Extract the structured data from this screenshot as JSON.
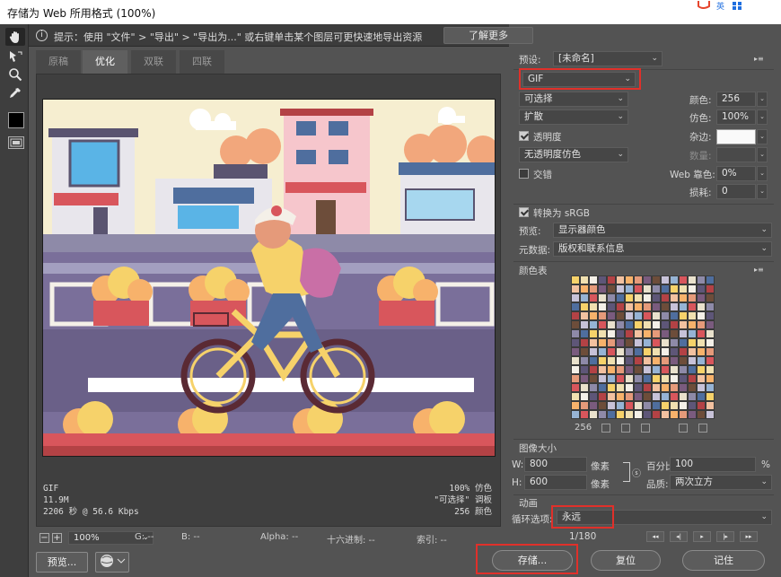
{
  "window": {
    "title": "存储为 Web 所用格式 (100%)",
    "logo_text": "英"
  },
  "hint": {
    "text": "提示：使用 \"文件\" > \"导出\" > \"导出为...\" 或右键单击某个图层可更快速地导出资源",
    "learn_more": "了解更多"
  },
  "tabs": [
    "原稿",
    "优化",
    "双联",
    "四联"
  ],
  "active_tab": "优化",
  "image_info": {
    "format": "GIF",
    "size": "11.9M",
    "download_time": "2206 秒 @ 56.6 Kbps",
    "dither": "100% 仿色",
    "palette": "\"可选择\" 调板",
    "colors": "256 颜色"
  },
  "statusbar": {
    "zoom": "100%",
    "g": "G: --",
    "b": "B: --",
    "alpha": "Alpha: --",
    "hex": "十六进制: --",
    "index": "索引: --"
  },
  "buttons": {
    "preview": "预览...",
    "save": "存储...",
    "reset": "复位",
    "remember": "记住"
  },
  "settings": {
    "preset_label": "预设:",
    "preset_value": "[未命名]",
    "format": "GIF",
    "reduction": "可选择",
    "dither_algo": "扩散",
    "transparency_label": "透明度",
    "transparency": true,
    "trans_dither": "无透明度仿色",
    "interlaced_label": "交错",
    "interlaced": false,
    "colors_label": "颜色:",
    "colors_value": "256",
    "dither_label": "仿色:",
    "dither_value": "100%",
    "matte_label": "杂边:",
    "amount_label": "数量:",
    "web_snap_label": "Web 靠色:",
    "web_snap_value": "0%",
    "lossy_label": "损耗:",
    "lossy_value": "0",
    "convert_srgb_label": "转换为 sRGB",
    "convert_srgb": true,
    "preview_label": "预览:",
    "preview_value": "显示器颜色",
    "metadata_label": "元数据:",
    "metadata_value": "版权和联系信息"
  },
  "color_table": {
    "title": "颜色表",
    "count": "256",
    "colors": [
      "#f6d26a",
      "#e59a7a",
      "#8e8aa8",
      "#f2c1a0",
      "#d8565c",
      "#5e5678",
      "#c7c2d8",
      "#f0e0b0",
      "#7a5b7e",
      "#4f6e9e",
      "#f7b26b",
      "#e9e1cc",
      "#b34245",
      "#96b3d4",
      "#f4f0e8",
      "#6d4d3a"
    ]
  },
  "image_size": {
    "title": "图像大小",
    "w_label": "W:",
    "w_value": "800",
    "h_label": "H:",
    "h_value": "600",
    "unit": "像素",
    "percent_label": "百分比:",
    "percent_value": "100",
    "percent_unit": "%",
    "quality_label": "品质:",
    "quality_value": "两次立方"
  },
  "animation": {
    "title": "动画",
    "loop_label": "循环选项:",
    "loop_value": "永远",
    "frame": "1/180"
  }
}
